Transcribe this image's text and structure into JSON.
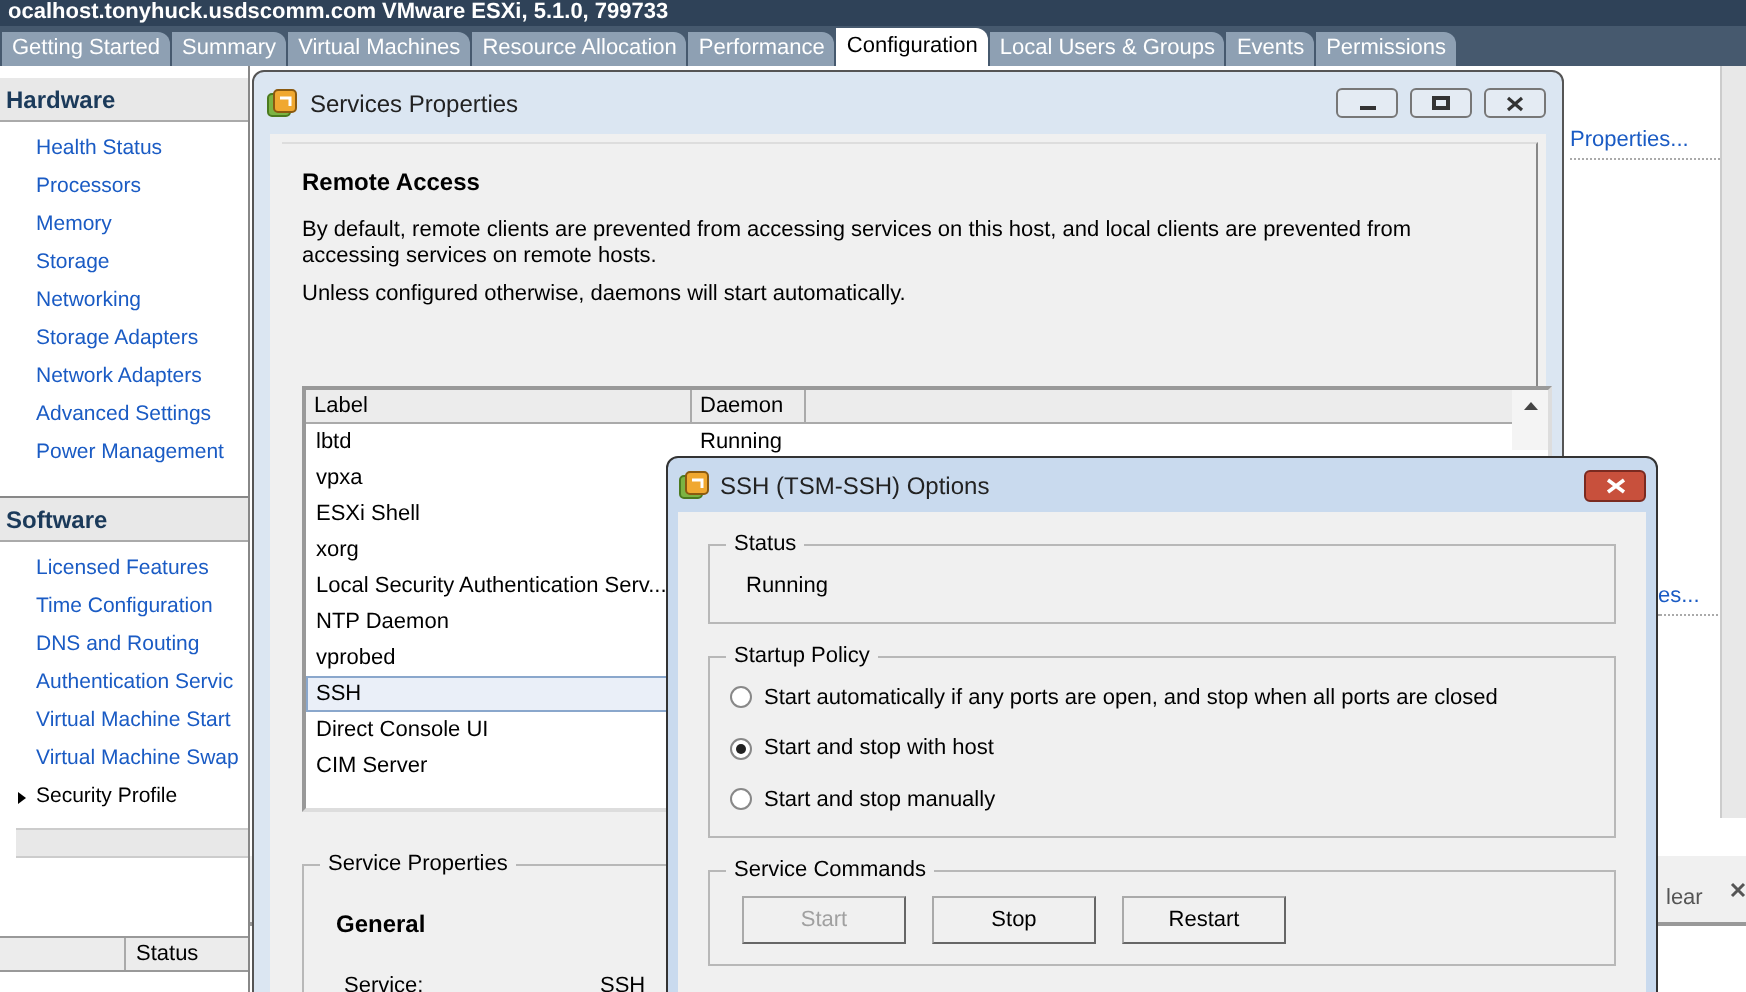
{
  "app": {
    "title": "ocalhost.tonyhuck.usdscomm.com VMware ESXi, 5.1.0, 799733"
  },
  "tabs": [
    {
      "label": "Getting Started",
      "selected": false
    },
    {
      "label": "Summary",
      "selected": false
    },
    {
      "label": "Virtual Machines",
      "selected": false
    },
    {
      "label": "Resource Allocation",
      "selected": false
    },
    {
      "label": "Performance",
      "selected": false
    },
    {
      "label": "Configuration",
      "selected": true
    },
    {
      "label": "Local Users & Groups",
      "selected": false
    },
    {
      "label": "Events",
      "selected": false
    },
    {
      "label": "Permissions",
      "selected": false
    }
  ],
  "sidebar": {
    "sections": [
      {
        "title": "Hardware",
        "items": [
          {
            "label": "Health Status",
            "selected": false
          },
          {
            "label": "Processors",
            "selected": false
          },
          {
            "label": "Memory",
            "selected": false
          },
          {
            "label": "Storage",
            "selected": false
          },
          {
            "label": "Networking",
            "selected": false
          },
          {
            "label": "Storage Adapters",
            "selected": false
          },
          {
            "label": "Network Adapters",
            "selected": false
          },
          {
            "label": "Advanced Settings",
            "selected": false
          },
          {
            "label": "Power Management",
            "selected": false
          }
        ]
      },
      {
        "title": "Software",
        "items": [
          {
            "label": "Licensed Features",
            "selected": false
          },
          {
            "label": "Time Configuration",
            "selected": false
          },
          {
            "label": "DNS and Routing",
            "selected": false
          },
          {
            "label": "Authentication Servic",
            "selected": false
          },
          {
            "label": "Virtual Machine Start",
            "selected": false
          },
          {
            "label": "Virtual Machine Swap",
            "selected": false
          },
          {
            "label": "Security Profile",
            "selected": true
          }
        ]
      }
    ],
    "bottom_column": "Status"
  },
  "right_pane": {
    "links": [
      "Properties...",
      "es..."
    ],
    "bottom_text": "lear"
  },
  "services_dialog": {
    "title": "Services Properties",
    "heading": "Remote Access",
    "paragraphs": [
      "By default, remote clients are prevented from accessing services on this host, and local clients are prevented from accessing services on remote hosts.",
      "Unless configured otherwise, daemons will start automatically."
    ],
    "columns": [
      "Label",
      "Daemon"
    ],
    "rows": [
      {
        "label": "lbtd",
        "daemon": "Running",
        "selected": false
      },
      {
        "label": "vpxa",
        "selected": false
      },
      {
        "label": "ESXi Shell",
        "selected": false
      },
      {
        "label": "xorg",
        "selected": false
      },
      {
        "label": "Local Security Authentication Serv...",
        "selected": false
      },
      {
        "label": "NTP Daemon",
        "selected": false
      },
      {
        "label": "vprobed",
        "selected": false
      },
      {
        "label": "SSH",
        "selected": true
      },
      {
        "label": "Direct Console UI",
        "selected": false
      },
      {
        "label": "CIM Server",
        "selected": false
      }
    ],
    "group_title": "Service Properties",
    "section": "General",
    "fields": [
      {
        "label": "Service:",
        "value": "SSH"
      }
    ]
  },
  "ssh_dialog": {
    "title": "SSH (TSM-SSH) Options",
    "status": {
      "title": "Status",
      "value": "Running"
    },
    "startup_policy": {
      "title": "Startup Policy",
      "options": [
        {
          "label": "Start automatically if any ports are open, and stop when all ports are closed",
          "selected": false
        },
        {
          "label": "Start and stop with host",
          "selected": true
        },
        {
          "label": "Start and stop manually",
          "selected": false
        }
      ]
    },
    "service_commands": {
      "title": "Service Commands",
      "buttons": [
        {
          "label": "Start",
          "disabled": true
        },
        {
          "label": "Stop",
          "disabled": false
        },
        {
          "label": "Restart",
          "disabled": false
        }
      ]
    }
  }
}
